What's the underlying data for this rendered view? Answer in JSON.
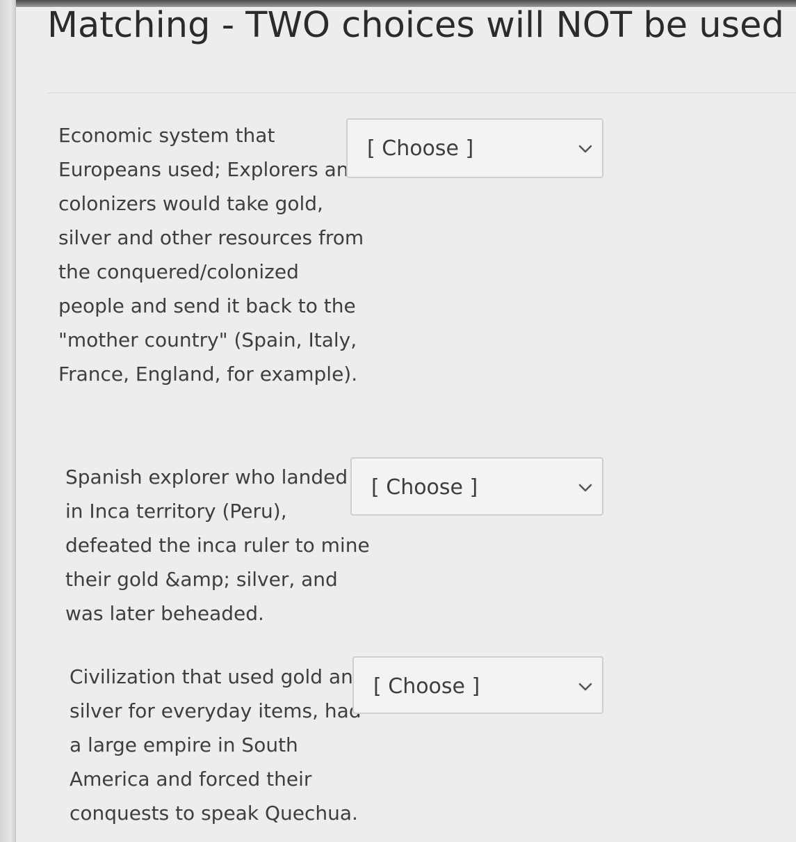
{
  "quiz": {
    "title": "Matching - TWO choices will NOT be used"
  },
  "questions": [
    {
      "prompt": "Economic system that Europeans used; Explorers and colonizers would take gold, silver and other resources from the conquered/colonized people and send it back to the \"mother country\" (Spain, Italy, France, England, for example).",
      "select_value": "[ Choose ]"
    },
    {
      "prompt": "Spanish explorer who landed in Inca territory (Peru), defeated the inca ruler to mine their gold &amp; silver, and was later beheaded.",
      "select_value": "[ Choose ]"
    },
    {
      "prompt": "Civilization that used gold and silver for everyday items, had a large empire in South America and forced their conquests to speak Quechua.",
      "select_value": "[ Choose ]"
    }
  ],
  "icons": {
    "dropdown": "chevron-down-icon"
  },
  "colors": {
    "background": "#ededec",
    "text": "#3d3e40",
    "select_border": "#cfcfcd"
  }
}
